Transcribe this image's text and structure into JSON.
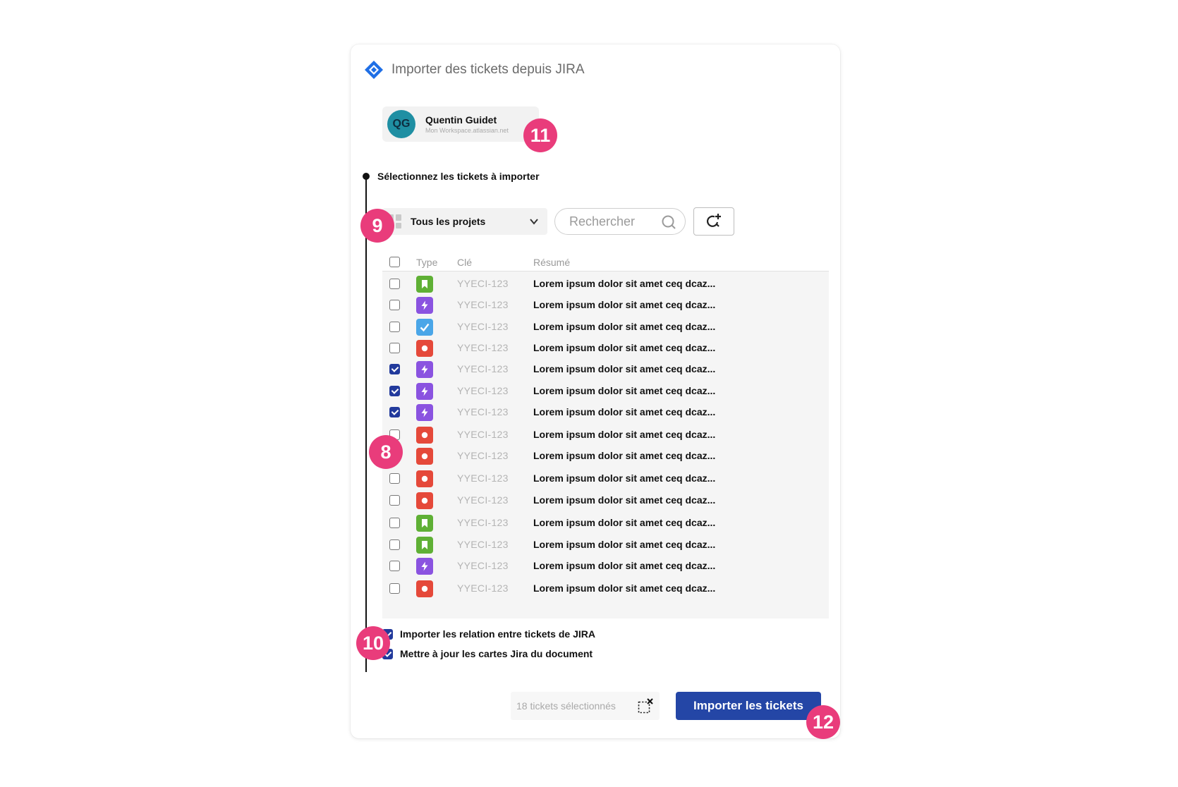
{
  "dialog": {
    "title": "Importer des tickets depuis JIRA",
    "icon": "jira-logo"
  },
  "account": {
    "initials": "QG",
    "name": "Quentin Guidet",
    "workspace": "Mon Workspace.atlassian.net"
  },
  "step": {
    "label": "Sélectionnez les tickets à importer"
  },
  "filters": {
    "project_label": "Tous les projets",
    "search_placeholder": "Rechercher"
  },
  "table": {
    "headers": {
      "type": "Type",
      "key": "Clé",
      "summary": "Résumé"
    },
    "rows": [
      {
        "checked": false,
        "type": "story",
        "key": "YYECI-123",
        "summary": "Lorem ipsum dolor sit amet ceq dcaz..."
      },
      {
        "checked": false,
        "type": "epic",
        "key": "YYECI-123",
        "summary": "Lorem ipsum dolor sit amet ceq dcaz..."
      },
      {
        "checked": false,
        "type": "task",
        "key": "YYECI-123",
        "summary": "Lorem ipsum dolor sit amet ceq dcaz..."
      },
      {
        "checked": false,
        "type": "bug",
        "key": "YYECI-123",
        "summary": "Lorem ipsum dolor sit amet ceq dcaz..."
      },
      {
        "checked": true,
        "type": "epic",
        "key": "YYECI-123",
        "summary": "Lorem ipsum dolor sit amet ceq dcaz..."
      },
      {
        "checked": true,
        "type": "epic",
        "key": "YYECI-123",
        "summary": "Lorem ipsum dolor sit amet ceq dcaz..."
      },
      {
        "checked": true,
        "type": "epic",
        "key": "YYECI-123",
        "summary": "Lorem ipsum dolor sit amet ceq dcaz..."
      },
      {
        "checked": false,
        "type": "bug",
        "key": "YYECI-123",
        "summary": "Lorem ipsum dolor sit amet ceq dcaz..."
      },
      {
        "checked": false,
        "type": "bug",
        "key": "YYECI-123",
        "summary": "Lorem ipsum dolor sit amet ceq dcaz..."
      },
      {
        "checked": false,
        "type": "bug",
        "key": "YYECI-123",
        "summary": "Lorem ipsum dolor sit amet ceq dcaz..."
      },
      {
        "checked": false,
        "type": "bug",
        "key": "YYECI-123",
        "summary": "Lorem ipsum dolor sit amet ceq dcaz..."
      },
      {
        "checked": false,
        "type": "story",
        "key": "YYECI-123",
        "summary": "Lorem ipsum dolor sit amet ceq dcaz..."
      },
      {
        "checked": false,
        "type": "story",
        "key": "YYECI-123",
        "summary": "Lorem ipsum dolor sit amet ceq dcaz..."
      },
      {
        "checked": false,
        "type": "epic",
        "key": "YYECI-123",
        "summary": "Lorem ipsum dolor sit amet ceq dcaz..."
      },
      {
        "checked": false,
        "type": "bug",
        "key": "YYECI-123",
        "summary": "Lorem ipsum dolor sit amet ceq dcaz..."
      }
    ]
  },
  "options": [
    {
      "checked": true,
      "label": "Importer les relation entre tickets de JIRA"
    },
    {
      "checked": true,
      "label": "Mettre à jour les cartes Jira du document"
    }
  ],
  "footer": {
    "selected_count_text": "18 tickets sélectionnés",
    "import_button": "Importer les tickets"
  },
  "annotations": [
    "8",
    "9",
    "10",
    "11",
    "12"
  ],
  "colors": {
    "story": "#5fb035",
    "epic": "#8a53e0",
    "task": "#4aa6e8",
    "bug": "#e5493a",
    "primary": "#2446a6",
    "badge": "#e93c7b"
  }
}
